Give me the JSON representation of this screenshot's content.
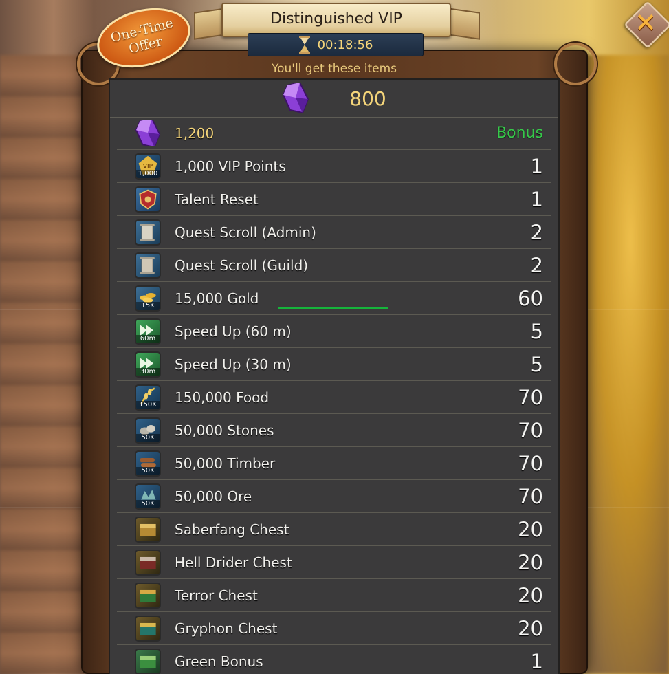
{
  "title": "Distinguished VIP",
  "timer": "00:18:56",
  "subtitle": "You'll get these items",
  "offer_badge": [
    "One-Time",
    "Offer"
  ],
  "close_label": "✕",
  "gems": {
    "amount": "800"
  },
  "colors": {
    "accent_gold": "#f5d57a",
    "bonus_green": "#37c94b",
    "panel": "#3b3a3b"
  },
  "items": [
    {
      "name": "1,200",
      "qty": "Bonus",
      "icon": "purple-gem-icon",
      "tag": ""
    },
    {
      "name": "1,000 VIP Points",
      "qty": "1",
      "icon": "vip-points-icon",
      "tag": "1,000"
    },
    {
      "name": "Talent Reset",
      "qty": "1",
      "icon": "talent-reset-icon",
      "tag": ""
    },
    {
      "name": "Quest Scroll (Admin)",
      "qty": "2",
      "icon": "quest-scroll-admin-icon",
      "tag": ""
    },
    {
      "name": "Quest Scroll (Guild)",
      "qty": "2",
      "icon": "quest-scroll-guild-icon",
      "tag": ""
    },
    {
      "name": "15,000 Gold",
      "qty": "60",
      "icon": "gold-coins-icon",
      "tag": "15K"
    },
    {
      "name": "Speed Up (60 m)",
      "qty": "5",
      "icon": "speed-up-icon",
      "tag": "60m"
    },
    {
      "name": "Speed Up (30 m)",
      "qty": "5",
      "icon": "speed-up-icon",
      "tag": "30m"
    },
    {
      "name": "150,000 Food",
      "qty": "70",
      "icon": "food-icon",
      "tag": "150K"
    },
    {
      "name": "50,000 Stones",
      "qty": "70",
      "icon": "stones-icon",
      "tag": "50K"
    },
    {
      "name": "50,000 Timber",
      "qty": "70",
      "icon": "timber-icon",
      "tag": "50K"
    },
    {
      "name": "50,000 Ore",
      "qty": "70",
      "icon": "ore-icon",
      "tag": "50K"
    },
    {
      "name": "Saberfang Chest",
      "qty": "20",
      "icon": "saberfang-chest-icon",
      "tag": ""
    },
    {
      "name": "Hell Drider Chest",
      "qty": "20",
      "icon": "hell-drider-chest-icon",
      "tag": ""
    },
    {
      "name": "Terror Chest",
      "qty": "20",
      "icon": "terror-chest-icon",
      "tag": ""
    },
    {
      "name": "Gryphon Chest",
      "qty": "20",
      "icon": "gryphon-chest-icon",
      "tag": ""
    },
    {
      "name": "Green Bonus",
      "qty": "1",
      "icon": "green-bonus-chest-icon",
      "tag": ""
    }
  ]
}
